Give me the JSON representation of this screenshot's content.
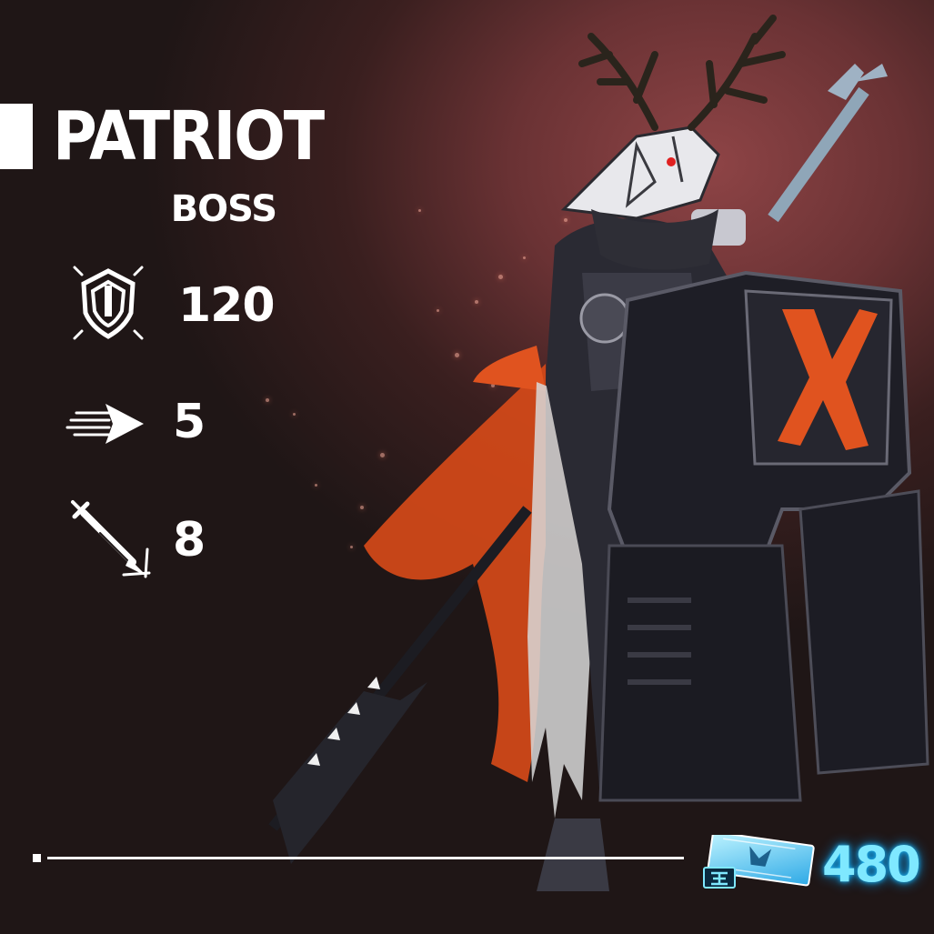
{
  "unit": {
    "name": "PATRIOT",
    "rank": "BOSS"
  },
  "stats": [
    {
      "icon": "defense-shield-icon",
      "value": "120"
    },
    {
      "icon": "movement-speed-arrow-icon",
      "value": "5"
    },
    {
      "icon": "attack-sword-icon",
      "value": "8"
    }
  ],
  "cost": {
    "icon": "ticket-icon",
    "value": "480"
  },
  "colors": {
    "background_glow": "#8e4446",
    "background_dark": "#1f1616",
    "text": "#ffffff",
    "cost_text": "#7fe8ff",
    "cost_glow": "#1bbcff",
    "accent_orange": "#e0531f"
  }
}
